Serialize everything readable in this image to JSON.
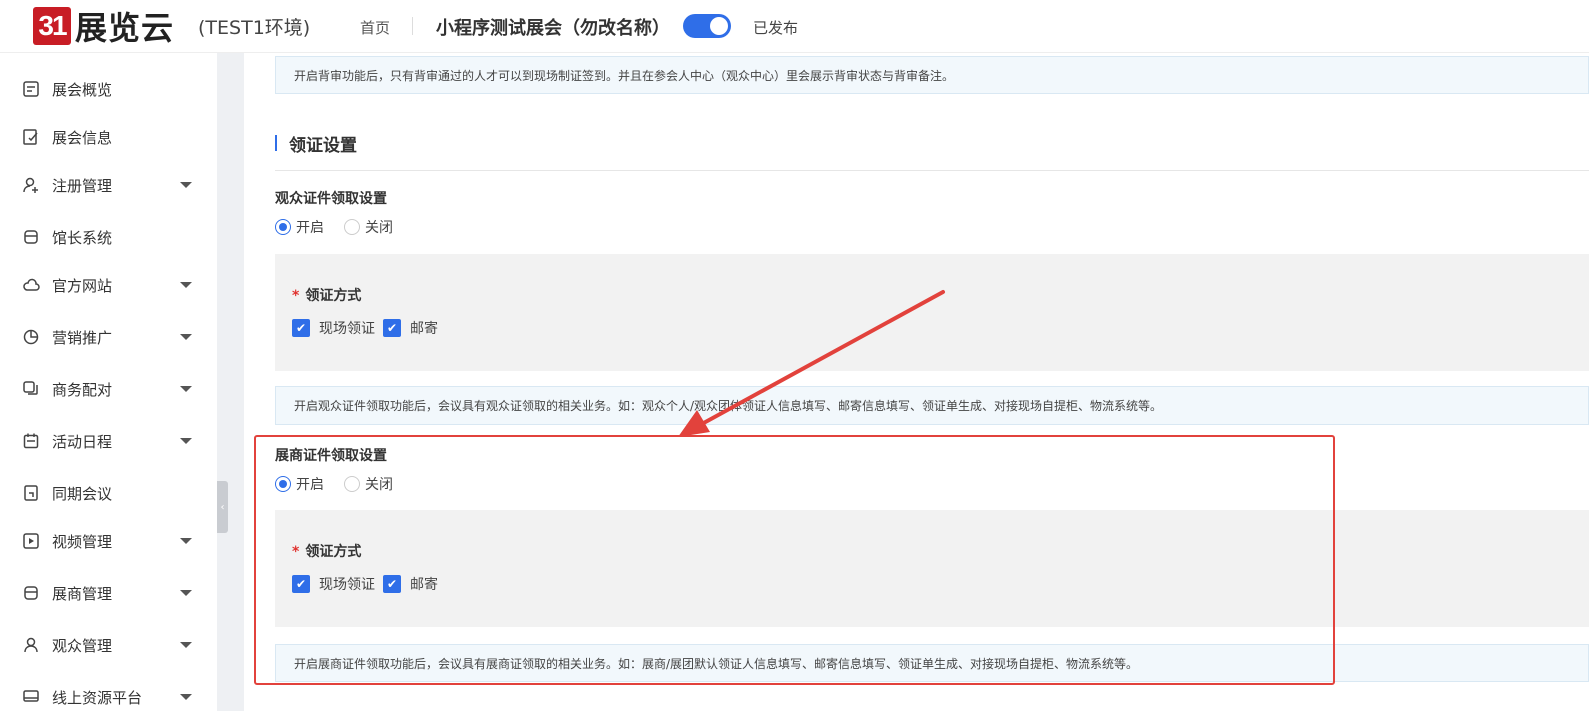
{
  "header": {
    "logo_mark": "31",
    "logo_text": "展览云",
    "environment": "(TEST1环境)",
    "home_label": "首页",
    "expo_title": "小程序测试展会（勿改名称）",
    "publish_status": "已发布",
    "publish_toggle_on": true
  },
  "sidebar": {
    "items": [
      {
        "label": "展会概览",
        "icon": "overview-icon",
        "has_caret": false
      },
      {
        "label": "展会信息",
        "icon": "edit-document-icon",
        "has_caret": false
      },
      {
        "label": "注册管理",
        "icon": "user-add-icon",
        "has_caret": true
      },
      {
        "label": "馆长系统",
        "icon": "store-icon",
        "has_caret": false
      },
      {
        "label": "官方网站",
        "icon": "cloud-icon",
        "has_caret": true
      },
      {
        "label": "营销推广",
        "icon": "pie-chart-icon",
        "has_caret": true
      },
      {
        "label": "商务配对",
        "icon": "copy-icon",
        "has_caret": true
      },
      {
        "label": "活动日程",
        "icon": "calendar-icon",
        "has_caret": true
      },
      {
        "label": "同期会议",
        "icon": "bookmark-icon",
        "has_caret": false
      },
      {
        "label": "视频管理",
        "icon": "video-icon",
        "has_caret": true
      },
      {
        "label": "展商管理",
        "icon": "store-icon",
        "has_caret": true
      },
      {
        "label": "观众管理",
        "icon": "user-icon",
        "has_caret": true
      },
      {
        "label": "线上资源平台",
        "icon": "monitor-icon",
        "has_caret": true
      }
    ]
  },
  "main": {
    "top_tip": "开启背审功能后，只有背审通过的人才可以到现场制证签到。并且在参会人中心（观众中心）里会展示背审状态与背审备注。",
    "section_title": "领证设置",
    "visitor": {
      "title": "观众证件领取设置",
      "radio_on": "开启",
      "radio_off": "关闭",
      "selected": "on",
      "method_label": "领证方式",
      "option_onsite": "现场领证",
      "option_mail": "邮寄",
      "onsite_checked": true,
      "mail_checked": true,
      "tip": "开启观众证件领取功能后，会议具有观众证领取的相关业务。如：观众个人/观众团体领证人信息填写、邮寄信息填写、领证单生成、对接现场自提柜、物流系统等。"
    },
    "exhibitor": {
      "title": "展商证件领取设置",
      "radio_on": "开启",
      "radio_off": "关闭",
      "selected": "on",
      "method_label": "领证方式",
      "option_onsite": "现场领证",
      "option_mail": "邮寄",
      "onsite_checked": true,
      "mail_checked": true,
      "tip": "开启展商证件领取功能后，会议具有展商证领取的相关业务。如：展商/展团默认领证人信息填写、邮寄信息填写、领证单生成、对接现场自提柜、物流系统等。"
    }
  },
  "colors": {
    "accent": "#2f6ee8",
    "annotation": "#e2423c",
    "required_star": "#e0322f"
  }
}
